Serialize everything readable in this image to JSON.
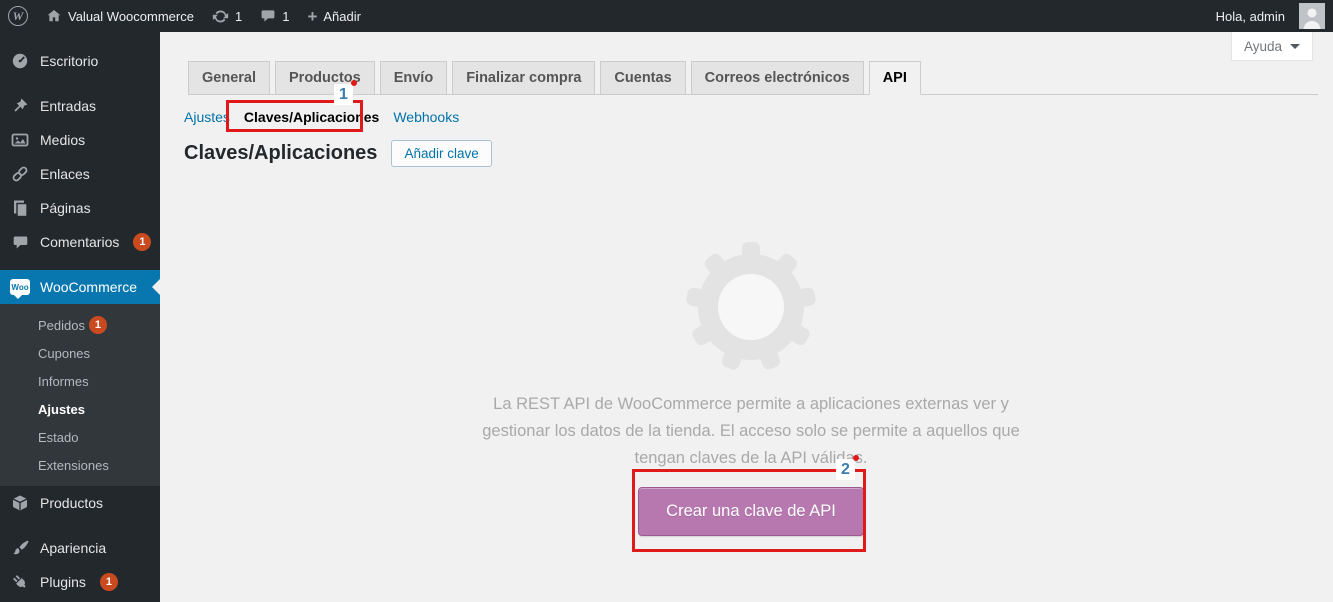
{
  "admin_bar": {
    "site_name": "Valual Woocommerce",
    "update_count": "1",
    "comment_count": "1",
    "new_label": "Añadir",
    "greeting": "Hola, admin"
  },
  "help": {
    "label": "Ayuda"
  },
  "sidebar": {
    "top": [
      {
        "label": "Escritorio"
      },
      {
        "label": "Entradas"
      },
      {
        "label": "Medios"
      },
      {
        "label": "Enlaces"
      },
      {
        "label": "Páginas"
      },
      {
        "label": "Comentarios",
        "badge": "1"
      }
    ],
    "woocommerce": {
      "label": "WooCommerce",
      "submenu": [
        {
          "label": "Pedidos",
          "badge": "1"
        },
        {
          "label": "Cupones"
        },
        {
          "label": "Informes"
        },
        {
          "label": "Ajustes",
          "current": true
        },
        {
          "label": "Estado"
        },
        {
          "label": "Extensiones"
        }
      ]
    },
    "bottom": [
      {
        "label": "Productos"
      },
      {
        "label": "Apariencia"
      },
      {
        "label": "Plugins",
        "badge": "1"
      }
    ]
  },
  "settings": {
    "tabs": [
      {
        "label": "General"
      },
      {
        "label": "Productos"
      },
      {
        "label": "Envío"
      },
      {
        "label": "Finalizar compra"
      },
      {
        "label": "Cuentas"
      },
      {
        "label": "Correos electrónicos"
      },
      {
        "label": "API",
        "active": true
      }
    ],
    "subnav": [
      {
        "label": "Ajustes"
      },
      {
        "label": "Claves/Aplicaciones",
        "current": true
      },
      {
        "label": "Webhooks"
      }
    ],
    "title": "Claves/Aplicaciones",
    "add_key_label": "Añadir clave",
    "api_intro": "La REST API de WooCommerce permite a aplicaciones externas ver y gestionar los datos de la tienda. El acceso solo se permite a aquellos que tengan claves de la API válidas.",
    "create_key_label": "Crear una clave de API"
  },
  "annotations": {
    "step1": "1",
    "step2": "2"
  },
  "icons": {
    "wp-logo": "W",
    "woocommerce-logo": "Woo",
    "home-icon": "house",
    "update-icon": "circular-arrows",
    "comments-icon": "speech-bubble",
    "add-icon": "plus",
    "escritorio-icon": "gauge",
    "entradas-icon": "pushpin",
    "medios-icon": "photo",
    "enlaces-icon": "chain-link",
    "paginas-icon": "stacked-pages",
    "comentarios-icon": "speech-bubble",
    "productos-icon": "cube",
    "apariencia-icon": "paintbrush",
    "plugins-icon": "plug",
    "help-caret-icon": "chevron-down",
    "gear-icon": "gear",
    "avatar-icon": "person"
  },
  "colors": {
    "adminbar_bg": "#23282d",
    "submenu_bg": "#32373c",
    "menu_active_blue": "#0877b0",
    "link_blue": "#0073aa",
    "badge_orange": "#ca4a1f",
    "button_purple": "#b678ae",
    "annotation_red": "#e01a1a",
    "annotation_blue": "#3d7dad",
    "content_bg": "#f1f1f1"
  }
}
